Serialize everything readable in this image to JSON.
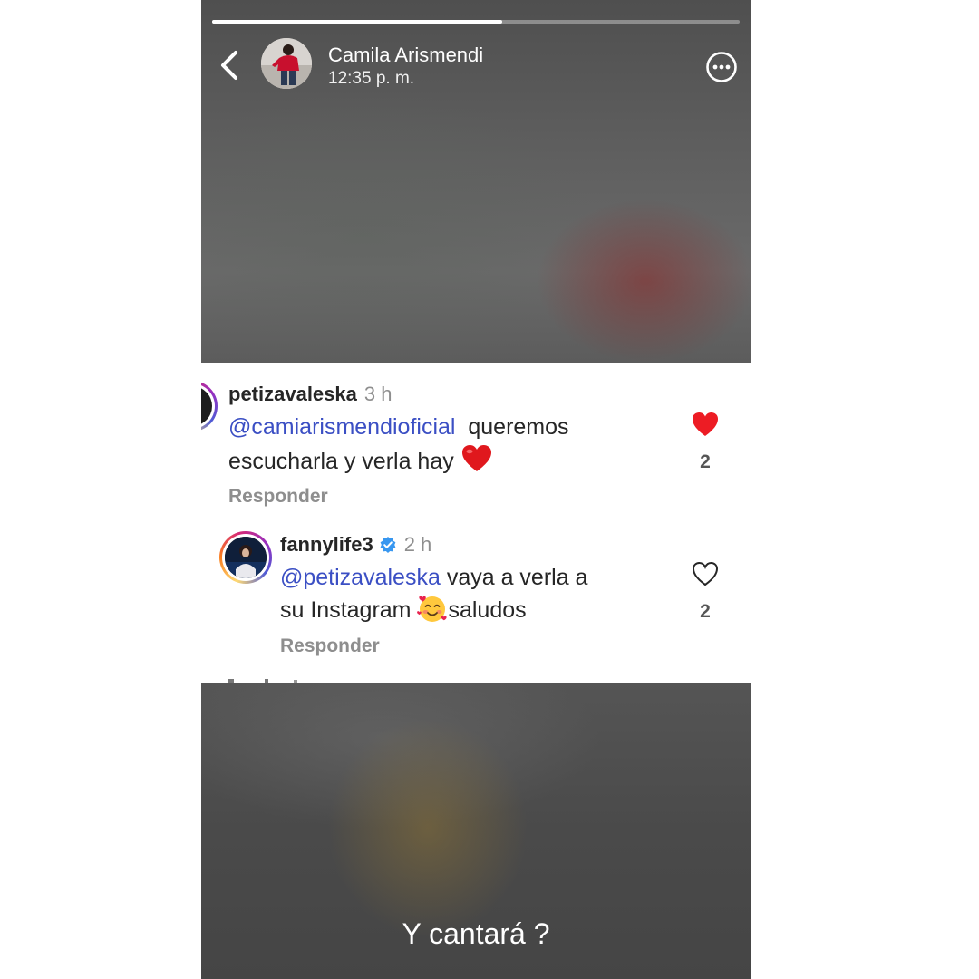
{
  "story": {
    "progress": 0.55,
    "user_name": "Camila Arismendi",
    "posted_time": "12:35 p. m.",
    "caption": "Y cantará ?"
  },
  "comments": [
    {
      "username": "petizavaleska",
      "time": "3 h",
      "mention": "@camiarismendioficial",
      "text_line1": "queremos",
      "text_line2": "escucharla y verla hay",
      "emoji": "red-heart",
      "reply_label": "Responder",
      "likes": "2",
      "liked": true,
      "like_color": "#ed1c24"
    },
    {
      "username": "fannylife3",
      "verified": true,
      "time": "2 h",
      "mention": "@petizavaleska",
      "text_line1": "vaya a verla a",
      "text_line2_before": "su Instagram",
      "emoji": "smiling-face-with-hearts",
      "text_line2_after": "saludos",
      "reply_label": "Responder",
      "likes": "2",
      "liked": false
    }
  ],
  "colors": {
    "mention": "#3b4fc4",
    "verified_badge": "#3897f0",
    "muted_text": "#8e8e8e"
  },
  "icons": {
    "back": "chevron-left-icon",
    "more": "more-horizontal-circle-icon",
    "like_filled": "heart-filled-icon",
    "like_outline": "heart-outline-icon",
    "verified": "verified-badge-icon"
  }
}
